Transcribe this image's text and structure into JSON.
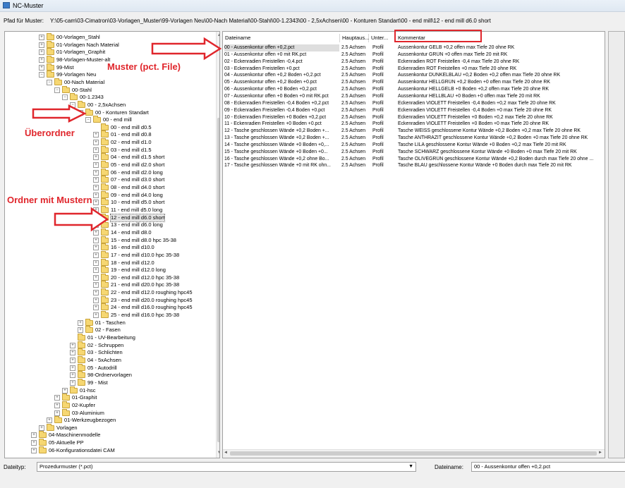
{
  "window": {
    "title": "NC-Muster"
  },
  "path": {
    "label": "Pfad für Muster:",
    "value": "Y:\\05-cam\\03-Cimatron\\03-Vorlagen_Muster\\99-Vorlagen Neu\\00-Nach Material\\00-Stahl\\00-1.2343\\00 - 2,5xAchsen\\00 - Konturen Standart\\00 - end mill\\12 - end mill d6.0 short"
  },
  "tree": [
    {
      "label": "00-Vorlagen_Stahl",
      "level": 3,
      "state": "plus"
    },
    {
      "label": "01-Vorlagen Nach Material",
      "level": 3,
      "state": "plus"
    },
    {
      "label": "01-Vorlagen_Graphit",
      "level": 3,
      "state": "plus"
    },
    {
      "label": "98-Vorlagen-Muster-alt",
      "level": 3,
      "state": "plus"
    },
    {
      "label": "99-Mist",
      "level": 3,
      "state": "plus"
    },
    {
      "label": "99-Vorlagen Neu",
      "level": 3,
      "state": "minus"
    },
    {
      "label": "00-Nach Material",
      "level": 4,
      "state": "minus"
    },
    {
      "label": "00-Stahl",
      "level": 5,
      "state": "minus"
    },
    {
      "label": "00-1.2343",
      "level": 6,
      "state": "minus"
    },
    {
      "label": "00 - 2,5xAchsen",
      "level": 7,
      "state": "minus"
    },
    {
      "label": "00 - Konturen Standart",
      "level": 8,
      "state": "minus"
    },
    {
      "label": "00 - end mill",
      "level": 9,
      "state": "minus"
    },
    {
      "label": "00 - end mill d0.5",
      "level": 10,
      "state": "none"
    },
    {
      "label": "01 - end mill d0.8",
      "level": 10,
      "state": "plus"
    },
    {
      "label": "02 - end mill d1.0",
      "level": 10,
      "state": "plus"
    },
    {
      "label": "03 - end mill d1.5",
      "level": 10,
      "state": "plus"
    },
    {
      "label": "04 - end mill d1.5 short",
      "level": 10,
      "state": "plus"
    },
    {
      "label": "05 - end mill d2.0 short",
      "level": 10,
      "state": "plus"
    },
    {
      "label": "06 - end mill d2.0 long",
      "level": 10,
      "state": "plus"
    },
    {
      "label": "07 - end mill d3.0 short",
      "level": 10,
      "state": "plus"
    },
    {
      "label": "08 - end mill d4.0 short",
      "level": 10,
      "state": "plus"
    },
    {
      "label": "09 - end mill d4.0 long",
      "level": 10,
      "state": "plus"
    },
    {
      "label": "10 - end mill d5.0 short",
      "level": 10,
      "state": "plus"
    },
    {
      "label": "11 - end mill d5.0 long",
      "level": 10,
      "state": "plus"
    },
    {
      "label": "12 - end mill d6.0 short",
      "level": 10,
      "state": "none",
      "selected": true
    },
    {
      "label": "13 - end mill d6.0 long",
      "level": 10,
      "state": "plus"
    },
    {
      "label": "14 - end mill d8.0",
      "level": 10,
      "state": "plus"
    },
    {
      "label": "15 - end mill d8.0 hpc 35-38",
      "level": 10,
      "state": "plus"
    },
    {
      "label": "16 - end mill d10.0",
      "level": 10,
      "state": "plus"
    },
    {
      "label": "17 - end mill d10.0 hpc 35-38",
      "level": 10,
      "state": "plus"
    },
    {
      "label": "18 - end mill d12.0",
      "level": 10,
      "state": "plus"
    },
    {
      "label": "19 - end mill d12.0 long",
      "level": 10,
      "state": "plus"
    },
    {
      "label": "20 - end mill d12.0 hpc 35-38",
      "level": 10,
      "state": "plus"
    },
    {
      "label": "21 - end mill d20.0 hpc 35-38",
      "level": 10,
      "state": "plus"
    },
    {
      "label": "22 - end mill d12.0 roughing hpc45",
      "level": 10,
      "state": "plus"
    },
    {
      "label": "23 - end mill d20.0 roughing hpc45",
      "level": 10,
      "state": "plus"
    },
    {
      "label": "24 - end mill d16.0 roughing hpc45",
      "level": 10,
      "state": "plus"
    },
    {
      "label": "25 - end mill d16.0 hpc 35-38",
      "level": 10,
      "state": "plus"
    },
    {
      "label": "01 - Taschen",
      "level": 8,
      "state": "plus"
    },
    {
      "label": "02 - Fasen",
      "level": 8,
      "state": "plus"
    },
    {
      "label": "01 - UV-Bearbeitung",
      "level": 7,
      "state": "none"
    },
    {
      "label": "02 - Schruppen",
      "level": 7,
      "state": "plus"
    },
    {
      "label": "03 - Schlichten",
      "level": 7,
      "state": "plus"
    },
    {
      "label": "04 - 5xAchsen",
      "level": 7,
      "state": "plus"
    },
    {
      "label": "05 - Autodrill",
      "level": 7,
      "state": "plus"
    },
    {
      "label": "98-Ordnervorlagen",
      "level": 7,
      "state": "plus"
    },
    {
      "label": "99 - Mist",
      "level": 7,
      "state": "plus"
    },
    {
      "label": "01-hsc",
      "level": 6,
      "state": "plus"
    },
    {
      "label": "01-Graphit",
      "level": 5,
      "state": "plus"
    },
    {
      "label": "02-Kupfer",
      "level": 5,
      "state": "plus"
    },
    {
      "label": "03-Aluminium",
      "level": 5,
      "state": "plus"
    },
    {
      "label": "01-Werkzeugbezogen",
      "level": 4,
      "state": "plus"
    },
    {
      "label": "Vorlagen",
      "level": 3,
      "state": "plus"
    },
    {
      "label": "04-Maschinenmodelle",
      "level": 2,
      "state": "plus"
    },
    {
      "label": "05-Aktuelle PP",
      "level": 2,
      "state": "plus"
    },
    {
      "label": "06-Konfigurationsdatei CAM",
      "level": 2,
      "state": "plus"
    }
  ],
  "list": {
    "headers": [
      "Dateiname",
      "Hauptaus...",
      "Unter...",
      "Kommentar"
    ],
    "rows": [
      [
        "00 - Aussenkontur offen +0,2.pct",
        "2.5 Achsen",
        "Profil",
        "Aussenkontur GELB +0,2 offen max Tiefe 20 ohne RK"
      ],
      [
        "01 - Aussenkontur offen +0 mit RK.pct",
        "2.5 Achsen",
        "Profil",
        "Aussenkontur GRÜN +0 offen max Tiefe 20 mit RK"
      ],
      [
        "02 - Eckenradien Freistellen -0,4.pct",
        "2.5 Achsen",
        "Profil",
        "Eckenradien ROT Freistellen -0,4 max Tiefe 20 ohne RK"
      ],
      [
        "03 - Eckenradien Freistellen +0.pct",
        "2.5 Achsen",
        "Profil",
        "Eckenradien ROT Freistellen +0 max Tiefe 20 ohne RK"
      ],
      [
        "04 - Aussenkontur offen +0,2 Boden +0,2.pct",
        "2.5 Achsen",
        "Profil",
        "Aussenkontur DUNKELBLAU +0,2 Boden +0,2 offen max Tiefe 20 ohne RK"
      ],
      [
        "05 - Aussenkontur offen +0,2 Boden +0.pct",
        "2.5 Achsen",
        "Profil",
        "Aussenkontur HELLGRÜN +0,2 Boden +0 offen max Tiefe 20 ohne RK"
      ],
      [
        "06 - Aussenkontur offen +0 Boden +0,2.pct",
        "2.5 Achsen",
        "Profil",
        "Aussenkontur HELLGELB +0 Boden +0,2 offen max Tiefe 20 ohne RK"
      ],
      [
        "07 - Aussenkontur offen +0 Boden +0 mit RK.pct",
        "2.5 Achsen",
        "Profil",
        "Aussenkontur HELLBLAU +0 Boden +0 offen max Tiefe 20 mit RK"
      ],
      [
        "08 - Eckenradien Freistellen -0,4 Boden +0,2.pct",
        "2.5 Achsen",
        "Profil",
        "Eckenradien VIOLETT Freistellen -0,4 Boden +0,2 max Tiefe 20 ohne RK"
      ],
      [
        "09 - Eckenradien Freistellen -0,4 Boden +0.pct",
        "2.5 Achsen",
        "Profil",
        "Eckenradien VIOLETT Freistellen -0,4 Boden +0 max Tiefe 20 ohne RK"
      ],
      [
        "10 - Eckenradien Freistellen +0 Boden +0,2.pct",
        "2.5 Achsen",
        "Profil",
        "Eckenradien VIOLETT Freistellen +0 Boden +0,2 max Tiefe 20 ohne RK"
      ],
      [
        "11 - Eckenradien Freistellen +0 Boden +0.pct",
        "2.5 Achsen",
        "Profil",
        "Eckenradien VIOLETT Freistellen +0 Boden +0 max Tiefe 20 ohne RK"
      ],
      [
        "12 - Tasche geschlossen Wände +0,2 Boden +...",
        "2.5 Achsen",
        "Profil",
        "Tasche WEISS geschlossene Kontur Wände +0,2 Boden +0,2 max Tiefe 20 ohne RK"
      ],
      [
        "13 - Tasche geschlossen Wände +0,2 Boden +...",
        "2.5 Achsen",
        "Profil",
        "Tasche ANTHRAZIT geschlossene Kontur Wände +0,2 Boden +0 max Tiefe 20 ohne RK"
      ],
      [
        "14 - Tasche geschlossen Wände +0 Boden +0,...",
        "2.5 Achsen",
        "Profil",
        "Tasche LILA geschlossene Kontur Wände +0 Boden +0,2 max Tiefe 20 mit RK"
      ],
      [
        "15 - Tasche geschlossen Wände +0 Boden +0...",
        "2.5 Achsen",
        "Profil",
        "Tasche SCHWARZ geschlossene Kontur Wände +0 Boden +0 max Tiefe 20 mit RK"
      ],
      [
        "16 - Tasche geschlossen Wände +0,2 ohne Bo...",
        "2.5 Achsen",
        "Profil",
        "Tasche OLIVEGRÜN geschlossene Kontur Wände +0,2 Boden durch max Tiefe 20 ohne ..."
      ],
      [
        "17 - Tasche geschlossen Wände +0 mit RK ohn...",
        "2.5 Achsen",
        "Profil",
        "Tasche BLAU geschlossene Kontur Wände +0 Boden durch max Tiefe 20 mit RK"
      ]
    ]
  },
  "bottom": {
    "filetype_label": "Dateityp:",
    "filetype_value": "Prozedurmuster (*.pct)",
    "filename_label": "Dateiname:",
    "filename_value": "00 - Aussenkontur offen +0,2.pct"
  },
  "annotations": {
    "muster": "Muster (pct. File)",
    "ueberordner": "Überordner",
    "ordner_mit_mustern": "Ordner mit Mustern",
    "color": "#e0262c"
  }
}
